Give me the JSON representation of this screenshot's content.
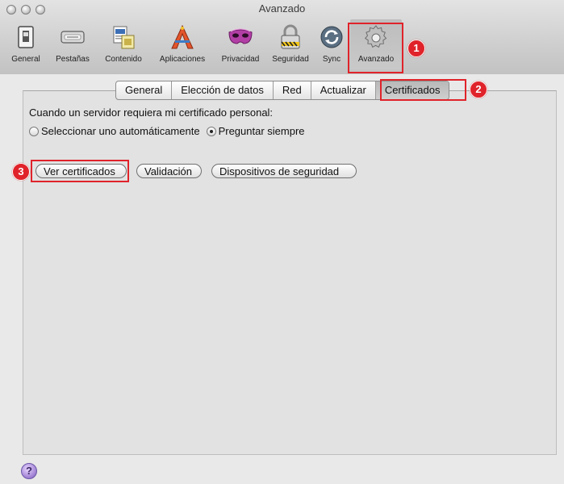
{
  "window": {
    "title": "Avanzado"
  },
  "toolbar": {
    "items": [
      {
        "label": "General",
        "icon": "switch-icon"
      },
      {
        "label": "Pestañas",
        "icon": "tabs-icon"
      },
      {
        "label": "Contenido",
        "icon": "content-icon"
      },
      {
        "label": "Aplicaciones",
        "icon": "applications-icon"
      },
      {
        "label": "Privacidad",
        "icon": "privacy-mask-icon"
      },
      {
        "label": "Seguridad",
        "icon": "padlock-icon"
      },
      {
        "label": "Sync",
        "icon": "sync-icon"
      },
      {
        "label": "Avanzado",
        "icon": "gear-icon",
        "selected": true
      }
    ]
  },
  "tabs": {
    "items": [
      "General",
      "Elección de datos",
      "Red",
      "Actualizar",
      "Certificados"
    ],
    "active": "Certificados"
  },
  "certificates": {
    "question": "Cuando un servidor requiera mi certificado personal:",
    "option_auto": "Seleccionar uno automáticamente",
    "option_ask": "Preguntar siempre",
    "selected_option": "Preguntar siempre",
    "btn_view": "Ver certificados",
    "btn_validation": "Validación",
    "btn_devices": "Dispositivos de seguridad"
  },
  "annotations": {
    "badge1": "1",
    "badge2": "2",
    "badge3": "3"
  },
  "help": {
    "label": "?"
  },
  "colors": {
    "annotation_red": "#e0232a"
  }
}
